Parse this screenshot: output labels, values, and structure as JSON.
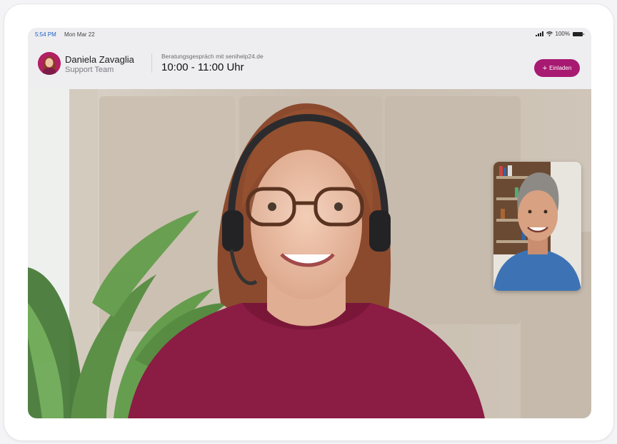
{
  "status_bar": {
    "time": "5:54 PM",
    "date": "Mon Mar 22",
    "battery": "100%"
  },
  "header": {
    "host_name": "Daniela Zavaglia",
    "host_role": "Support Team",
    "meeting_label": "Beratungsgespräch mit senihelp24.de",
    "meeting_time": "10:00 - 11:00 Uhr",
    "invite_label": "Einladen"
  },
  "colors": {
    "accent": "#a81a72",
    "avatar_bg": "#b21f63"
  },
  "icons": {
    "invite": "plus-icon",
    "wifi": "wifi-icon",
    "signal": "signal-icon",
    "battery": "battery-icon"
  }
}
